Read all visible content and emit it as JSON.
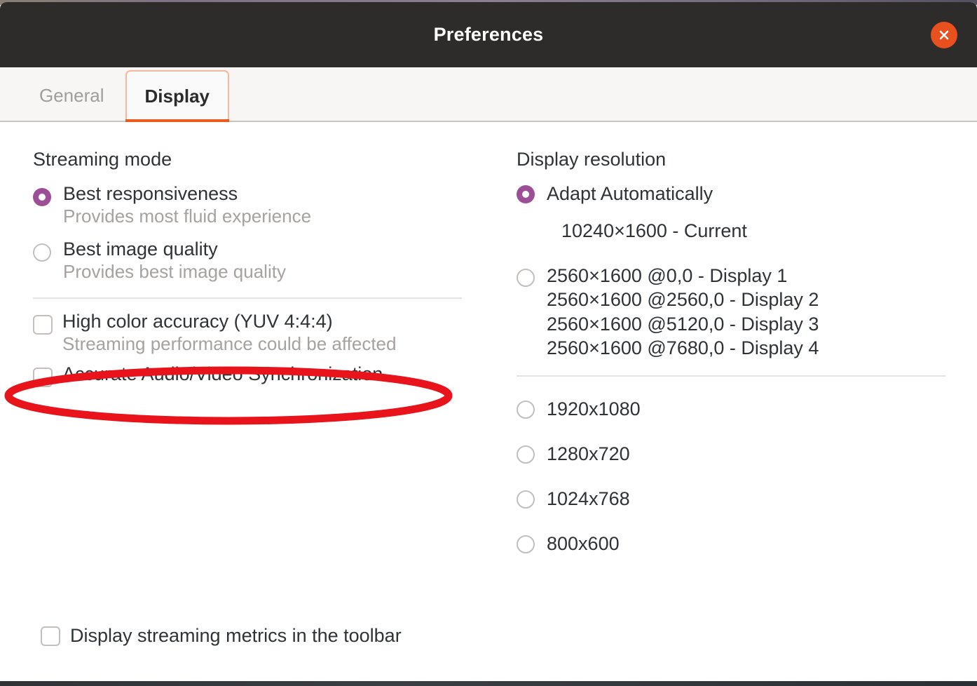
{
  "window": {
    "title": "Preferences",
    "close_icon": "close-icon"
  },
  "tabs": [
    {
      "label": "General",
      "active": false
    },
    {
      "label": "Display",
      "active": true
    }
  ],
  "streaming": {
    "section_title": "Streaming mode",
    "options": [
      {
        "title": "Best responsiveness",
        "subtitle": "Provides most fluid experience",
        "selected": true
      },
      {
        "title": "Best image quality",
        "subtitle": "Provides best image quality",
        "selected": false
      }
    ],
    "checkboxes": [
      {
        "title": "High color accuracy (YUV 4:4:4)",
        "subtitle": "Streaming performance could be affected",
        "checked": false
      },
      {
        "title": "Accurate Audio/Video Synchronization",
        "subtitle": "",
        "checked": false
      }
    ]
  },
  "resolution": {
    "section_title": "Display resolution",
    "adapt": {
      "label": "Adapt Automatically",
      "selected": true,
      "current": "10240×1600 - Current"
    },
    "multi_display": {
      "selected": false,
      "lines": [
        "2560×1600 @0,0 - Display 1",
        "2560×1600 @2560,0 - Display 2",
        "2560×1600 @5120,0 - Display 3",
        "2560×1600 @7680,0 - Display 4"
      ]
    },
    "fixed": [
      {
        "label": "1920x1080",
        "selected": false
      },
      {
        "label": "1280x720",
        "selected": false
      },
      {
        "label": "1024x768",
        "selected": false
      },
      {
        "label": "800x600",
        "selected": false
      }
    ]
  },
  "footer": {
    "metrics_label": "Display streaming metrics in the toolbar",
    "metrics_checked": false
  },
  "annotation": {
    "shape": "ellipse",
    "color": "#e8131b",
    "targets": "Accurate Audio/Video Synchronization"
  },
  "colors": {
    "titlebar_bg": "#2e2c2b",
    "close_bg": "#e8511d",
    "accent_tab": "#ea5b20",
    "radio_selected": "#9c4f96",
    "text": "#2f3336",
    "muted_text": "#a5a2a0"
  }
}
